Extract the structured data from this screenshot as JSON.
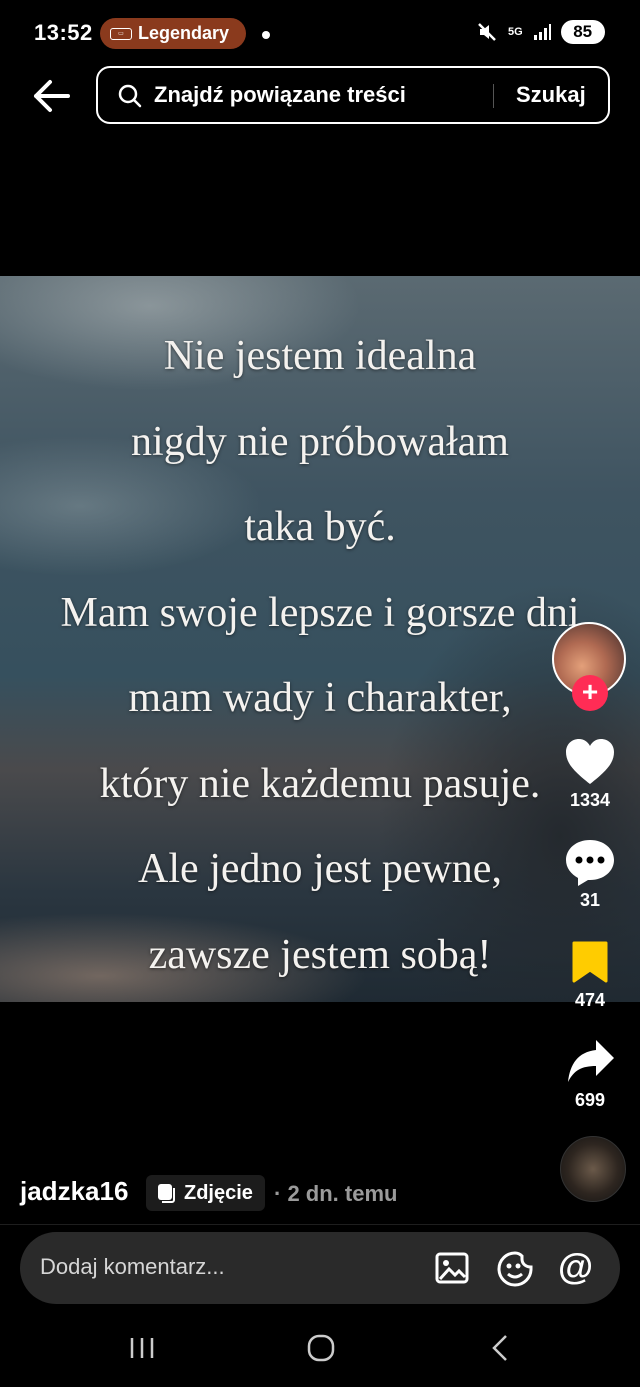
{
  "status_bar": {
    "time": "13:52",
    "app_badge": "Legendary",
    "network": "5G",
    "battery": "85"
  },
  "header": {
    "search_placeholder": "Znajdź powiązane treści",
    "search_button": "Szukaj"
  },
  "post": {
    "poem_lines": [
      "Nie jestem idealna",
      "nigdy nie próbowałam",
      "taka być.",
      "Mam swoje lepsze i gorsze dni",
      "mam wady i charakter,",
      "który nie każdemu pasuje.",
      "Ale jedno jest pewne,",
      "zawsze jestem sobą!"
    ],
    "username": "jadzka16",
    "type_badge": "Zdjęcie",
    "time_ago": "· 2 dn. temu"
  },
  "actions": {
    "likes": "1334",
    "comments": "31",
    "saves": "474",
    "shares": "699",
    "save_color": "#ffcc00",
    "follow_color": "#ff2c55"
  },
  "comment_bar": {
    "placeholder": "Dodaj komentarz..."
  },
  "icons": [
    "back-arrow-icon",
    "search-icon",
    "heart-icon",
    "comment-icon",
    "bookmark-icon",
    "share-icon",
    "image-icon",
    "emoji-icon",
    "mention-icon",
    "recents-icon",
    "home-icon",
    "nav-back-icon"
  ]
}
